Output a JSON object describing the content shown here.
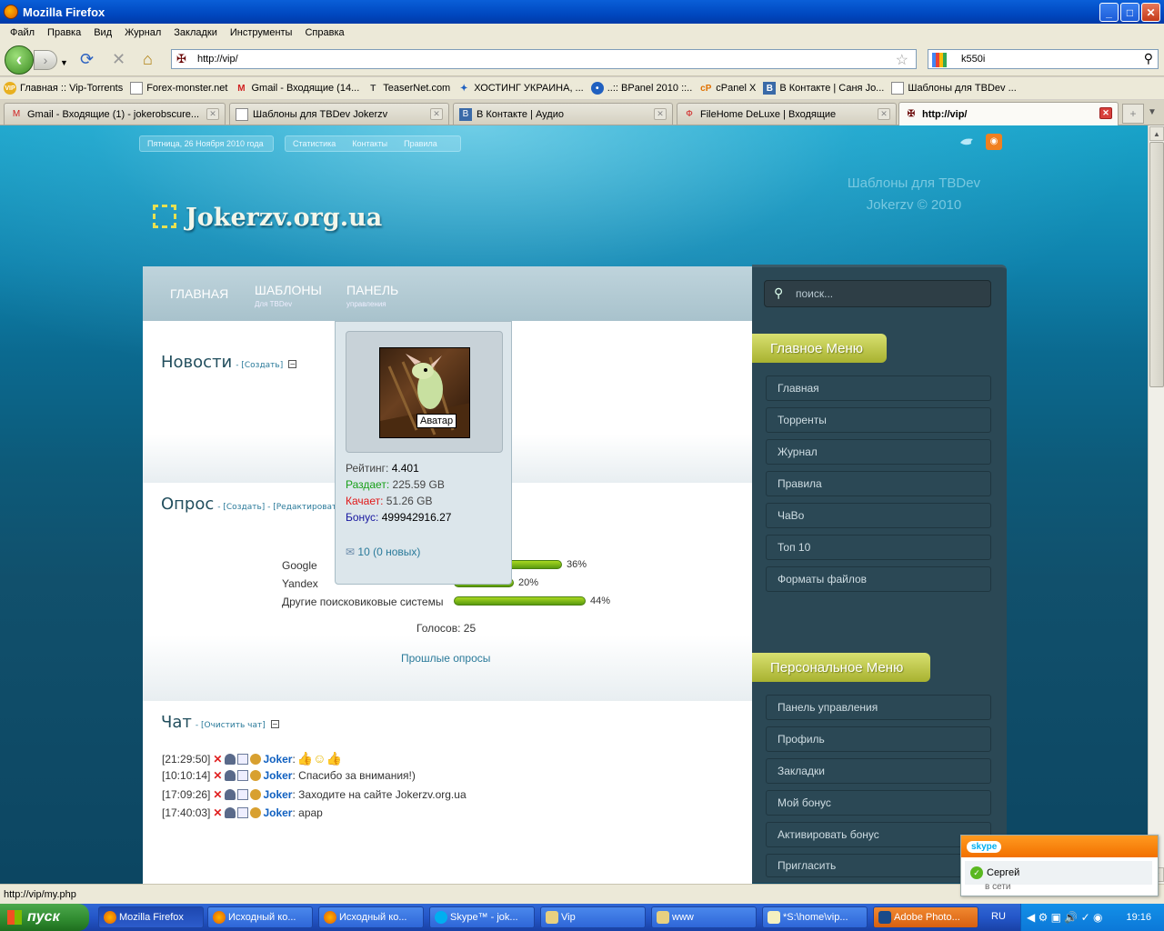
{
  "window": {
    "title": "Mozilla Firefox"
  },
  "menu": [
    "Файл",
    "Правка",
    "Вид",
    "Журнал",
    "Закладки",
    "Инструменты",
    "Справка"
  ],
  "toolbar": {
    "url": "http://vip/",
    "search_value": "k550i"
  },
  "bookmarks": [
    "Главная :: Vip-Torrents",
    "Forex-monster.net",
    "Gmail - Входящие (14...",
    "TeaserNet.com",
    "ХОСТИНГ УКРАИНА, ...",
    "..:: BPanel 2010 ::..",
    "cPanel X",
    "В Контакте | Саня Jo...",
    "Шаблоны для TBDev ..."
  ],
  "tabs": [
    "Gmail - Входящие (1) - jokerobscure...",
    "Шаблоны для TBDev Jokerzv",
    "В Контакте | Аудио",
    "FileHome DeLuxe | Входящие",
    "http://vip/"
  ],
  "site": {
    "date": "Пятница, 26 Ноября 2010 года",
    "toplinks": [
      "Статистика",
      "Контакты",
      "Правила"
    ],
    "logo": "Jokerzv.org.ua",
    "tagline1": "Шаблоны для TBDev",
    "tagline2": "Jokerzv © 2010",
    "nav": [
      {
        "label": "ГЛАВНАЯ",
        "sub": ""
      },
      {
        "label": "ШАБЛОНЫ",
        "sub": "Для TBDev"
      },
      {
        "label": "ПАНЕЛЬ",
        "sub": "управления"
      }
    ],
    "news_title": "Новости",
    "news_action": "[Создать]",
    "poll_title": "Опрос",
    "poll_actions": "- [Создать] - [Редактировать",
    "poll": [
      {
        "label": "Google",
        "pct": "36%",
        "value": 36
      },
      {
        "label": "Yandex",
        "pct": "20%",
        "value": 20
      },
      {
        "label": "Другие поисковиковые системы",
        "pct": "44%",
        "value": 44
      }
    ],
    "votes": "Голосов: 25",
    "past_polls": "Прошлые опросы",
    "chat_title": "Чат",
    "chat_action": "[Очистить чат]",
    "chat": [
      {
        "time": "[21:29:50]",
        "user": "Joker",
        "msg": ":"
      },
      {
        "time": "[10:10:14]",
        "user": "Joker",
        "msg": ": Спасибо за внимания!)"
      },
      {
        "time": "[17:09:26]",
        "user": "Joker",
        "msg": ": Заходите на сайте Jokerzv.org.ua"
      },
      {
        "time": "[17:40:03]",
        "user": "Joker",
        "msg": ": apap"
      }
    ],
    "search_placeholder": "поиск...",
    "main_menu_title": "Главное Меню",
    "main_menu": [
      "Главная",
      "Торренты",
      "Журнал",
      "Правила",
      "ЧаВо",
      "Топ 10",
      "Форматы файлов"
    ],
    "personal_menu_title": "Персональное Меню",
    "personal_menu": [
      "Панель управления",
      "Профиль",
      "Закладки",
      "Мой бонус",
      "Активировать бонус",
      "Пригласить"
    ]
  },
  "popup": {
    "avatar_tooltip": "Аватар",
    "rating_label": "Рейтинг:",
    "rating": "4.401",
    "seed_label": "Раздает:",
    "seed": "225.59 GB",
    "leech_label": "Качает:",
    "leech": "51.26 GB",
    "bonus_label": "Бонус:",
    "bonus": "499942916.27",
    "messages": "10 (0 новых)"
  },
  "status": "http://vip/my.php",
  "taskbar": {
    "start": "пуск",
    "tasks": [
      "Mozilla Firefox",
      "Исходный ко...",
      "Исходный ко...",
      "Skype™ - jok...",
      "Vip",
      "www",
      "*S:\\home\\vip...",
      "Adobe Photo..."
    ],
    "lang": "RU",
    "time": "19:16"
  },
  "skype": {
    "logo": "skype",
    "name": "Сергей",
    "state": "в сети"
  },
  "colors": {
    "accent": "#1e64c8",
    "sidebar": "#2b4855",
    "menu_head": "#c4cc48",
    "bar": "#7cb818"
  }
}
